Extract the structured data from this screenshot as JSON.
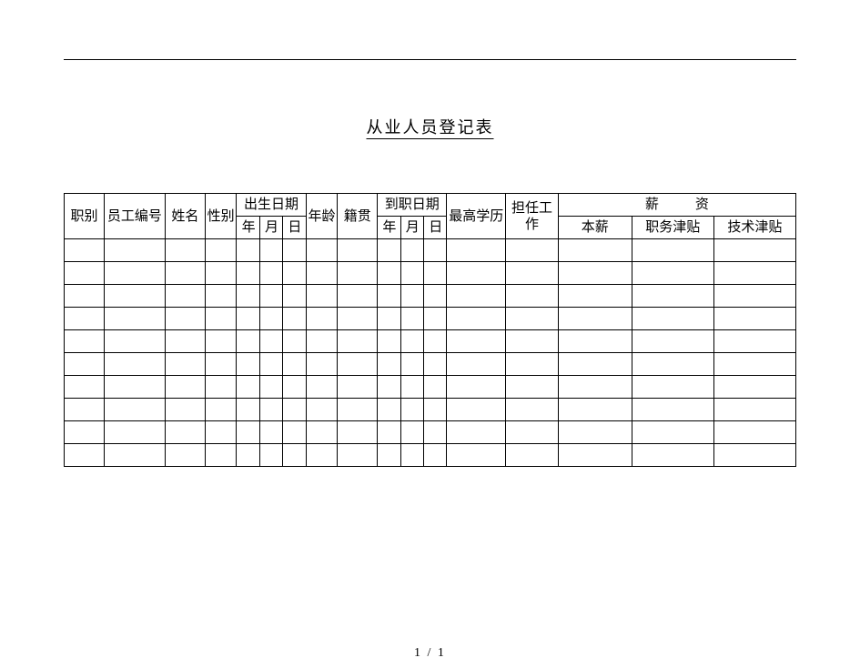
{
  "title": "从业人员登记表",
  "columns": {
    "job_category": "职别",
    "employee_id": "员工编号",
    "name": "姓名",
    "gender": "性别",
    "birth_date": "出生日期",
    "birth_year": "年",
    "birth_month": "月",
    "birth_day": "日",
    "age": "年龄",
    "native_place": "籍贯",
    "hire_date": "到职日期",
    "hire_year": "年",
    "hire_month": "月",
    "hire_day": "日",
    "highest_education": "最高学历",
    "assigned_work": "担任工作",
    "salary_group": "薪资",
    "base_salary": "本薪",
    "position_allowance": "职务津贴",
    "skill_allowance": "技术津贴"
  },
  "rows": [
    {},
    {},
    {},
    {},
    {},
    {},
    {},
    {},
    {},
    {}
  ],
  "footer": "1 / 1"
}
